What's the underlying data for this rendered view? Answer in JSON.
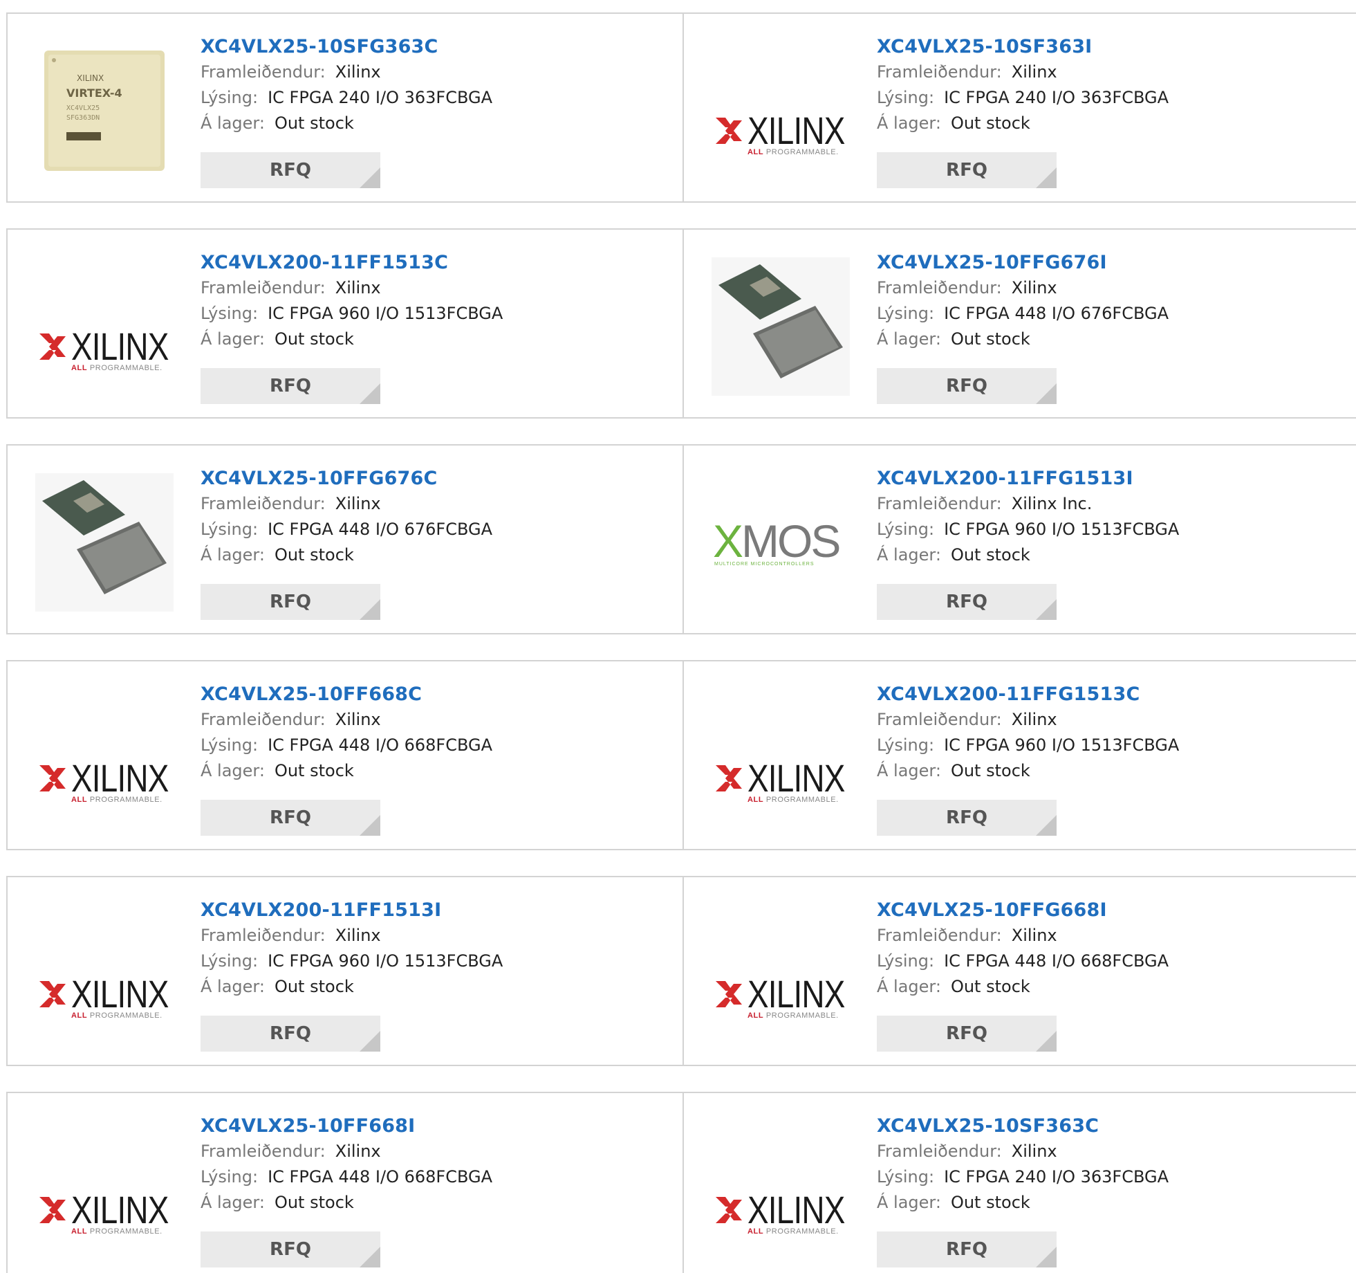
{
  "labels": {
    "manufacturer": "Framleiðendur:",
    "description": "Lýsing:",
    "stock": "Á lager:",
    "rfq": "RFQ"
  },
  "logos": {
    "xilinx_word": "XILINX",
    "xilinx_tag_all": "ALL",
    "xilinx_tag_rest": "PROGRAMMABLE.",
    "xmos_x": "X",
    "xmos_rest": "MOS",
    "xmos_sub": "MULTICORE MICROCONTROLLERS",
    "virtex_brand": "XILINX",
    "virtex_family": "VIRTEX-4",
    "virtex_part": "XC4VLX25",
    "virtex_pkg": "SFG363DN"
  },
  "colors": {
    "part_link": "#1f6dbd",
    "rfq_bg": "#eaeaea",
    "border": "#d3d3d3"
  },
  "products": [
    {
      "part": "XC4VLX25-10SFG363C",
      "manufacturer": "Xilinx",
      "description": "IC FPGA 240 I/O 363FCBGA",
      "stock": "Out stock",
      "image": "virtex-chip-photo"
    },
    {
      "part": "XC4VLX25-10SF363I",
      "manufacturer": "Xilinx",
      "description": "IC FPGA 240 I/O 363FCBGA",
      "stock": "Out stock",
      "image": "xilinx-logo"
    },
    {
      "part": "XC4VLX200-11FF1513C",
      "manufacturer": "Xilinx",
      "description": "IC FPGA 960 I/O 1513FCBGA",
      "stock": "Out stock",
      "image": "xilinx-logo"
    },
    {
      "part": "XC4VLX25-10FFG676I",
      "manufacturer": "Xilinx",
      "description": "IC FPGA 448 I/O 676FCBGA",
      "stock": "Out stock",
      "image": "bga-chip-photo"
    },
    {
      "part": "XC4VLX25-10FFG676C",
      "manufacturer": "Xilinx",
      "description": "IC FPGA 448 I/O 676FCBGA",
      "stock": "Out stock",
      "image": "bga-chip-photo"
    },
    {
      "part": "XC4VLX200-11FFG1513I",
      "manufacturer": "Xilinx Inc.",
      "description": "IC FPGA 960 I/O 1513FCBGA",
      "stock": "Out stock",
      "image": "xmos-logo"
    },
    {
      "part": "XC4VLX25-10FF668C",
      "manufacturer": "Xilinx",
      "description": "IC FPGA 448 I/O 668FCBGA",
      "stock": "Out stock",
      "image": "xilinx-logo"
    },
    {
      "part": "XC4VLX200-11FFG1513C",
      "manufacturer": "Xilinx",
      "description": "IC FPGA 960 I/O 1513FCBGA",
      "stock": "Out stock",
      "image": "xilinx-logo"
    },
    {
      "part": "XC4VLX200-11FF1513I",
      "manufacturer": "Xilinx",
      "description": "IC FPGA 960 I/O 1513FCBGA",
      "stock": "Out stock",
      "image": "xilinx-logo"
    },
    {
      "part": "XC4VLX25-10FFG668I",
      "manufacturer": "Xilinx",
      "description": "IC FPGA 448 I/O 668FCBGA",
      "stock": "Out stock",
      "image": "xilinx-logo"
    },
    {
      "part": "XC4VLX25-10FF668I",
      "manufacturer": "Xilinx",
      "description": "IC FPGA 448 I/O 668FCBGA",
      "stock": "Out stock",
      "image": "xilinx-logo"
    },
    {
      "part": "XC4VLX25-10SF363C",
      "manufacturer": "Xilinx",
      "description": "IC FPGA 240 I/O 363FCBGA",
      "stock": "Out stock",
      "image": "xilinx-logo"
    }
  ]
}
